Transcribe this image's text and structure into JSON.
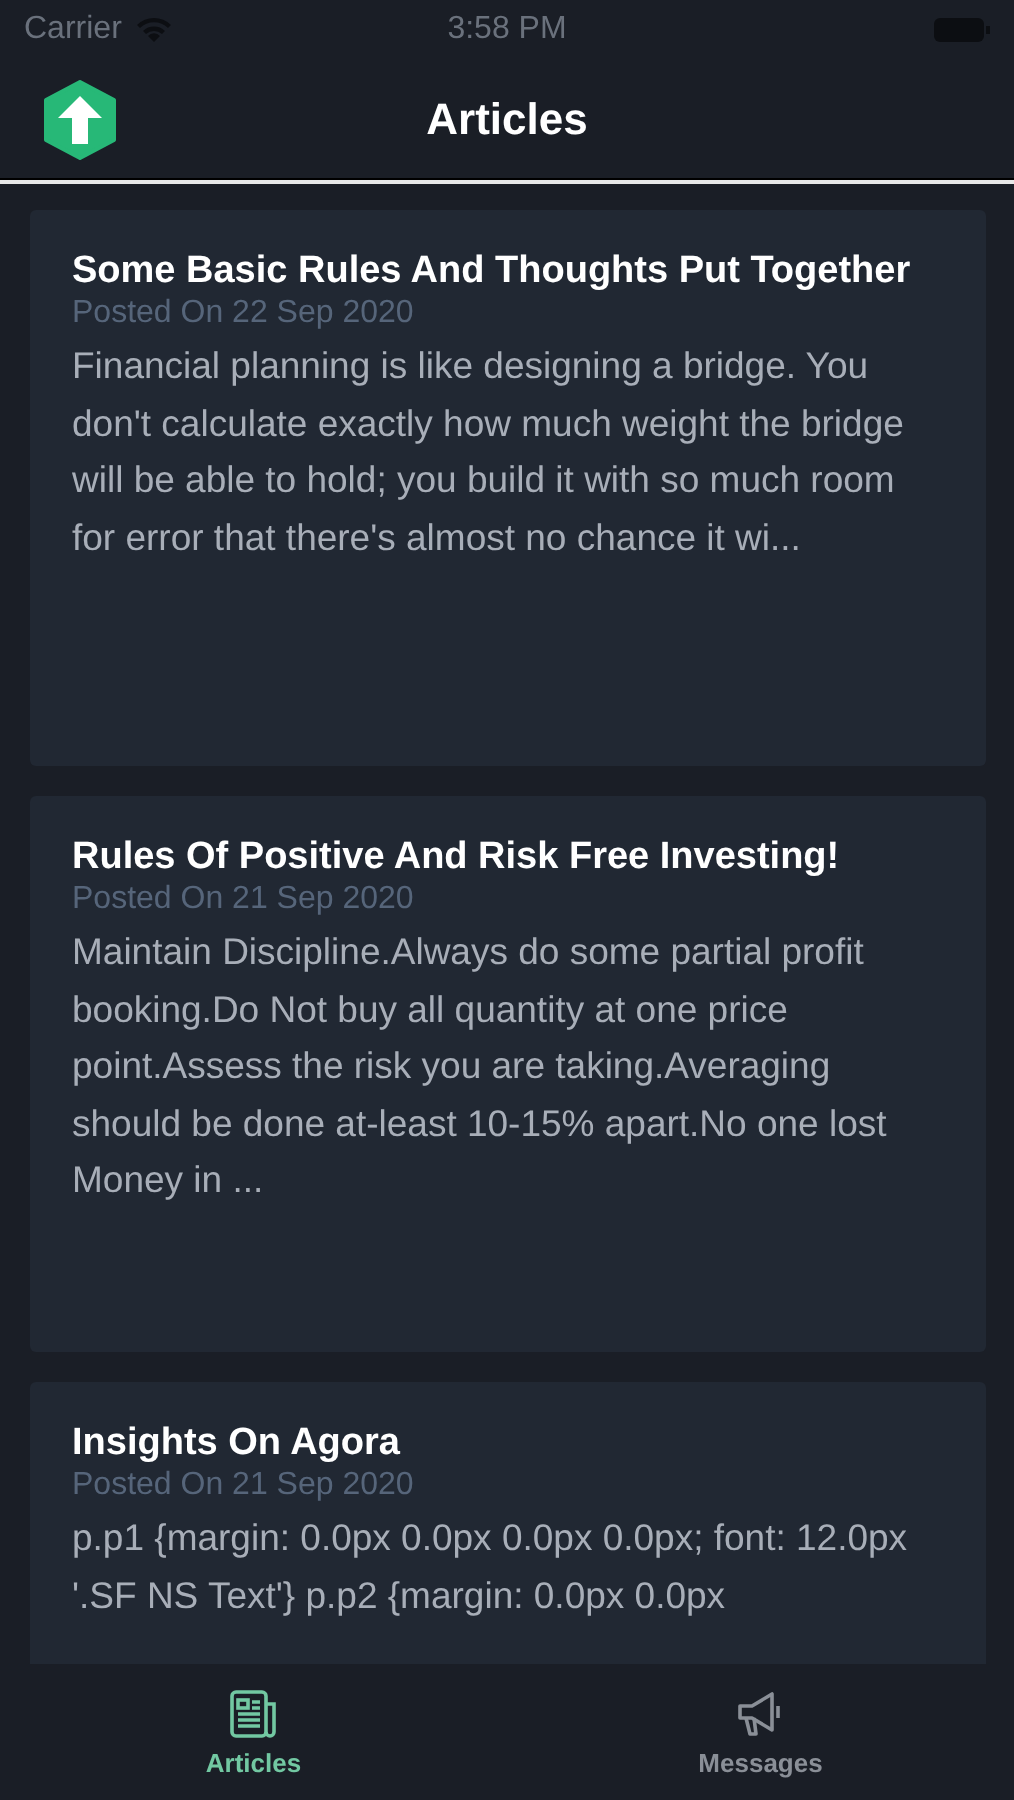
{
  "status_bar": {
    "carrier": "Carrier",
    "time": "3:58 PM"
  },
  "header": {
    "title": "Articles"
  },
  "articles": [
    {
      "title": "Some Basic Rules And Thoughts Put Together",
      "date": "Posted On 22 Sep 2020",
      "excerpt": "Financial planning is like designing a bridge. You don't calculate exactly how much weight the bridge will be able to hold; you build it with so much room for error that there's almost no chance it wi..."
    },
    {
      "title": "Rules Of Positive And Risk Free Investing!",
      "date": "Posted On 21 Sep 2020",
      "excerpt": "Maintain Discipline.Always do some partial profit booking.Do Not buy all quantity at one price point.Assess the risk you are taking.Averaging should be done at-least 10-15% apart.No one lost Money in ..."
    },
    {
      "title": "Insights On Agora",
      "date": "Posted On 21 Sep 2020",
      "excerpt": "p.p1 {margin: 0.0px 0.0px 0.0px 0.0px; font: 12.0px '.SF NS Text'} p.p2 {margin: 0.0px 0.0px"
    }
  ],
  "tabs": [
    {
      "label": "Articles",
      "selected": true
    },
    {
      "label": "Messages",
      "selected": false
    }
  ]
}
